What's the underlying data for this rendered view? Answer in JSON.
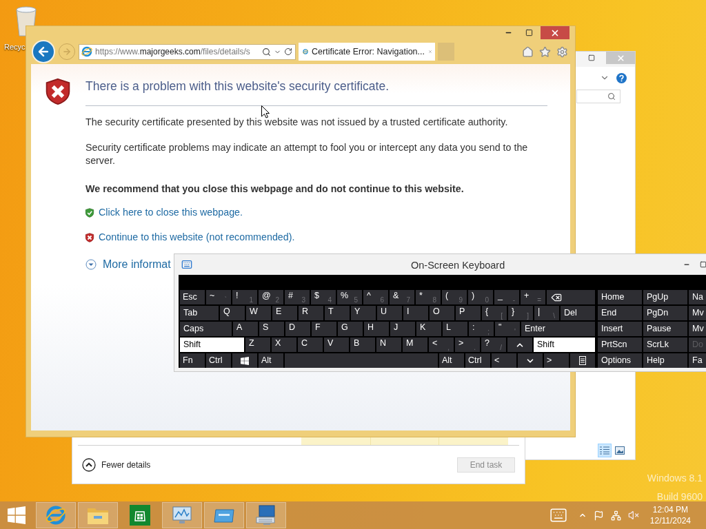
{
  "desktop": {
    "recycle_bin_label": "Recyc",
    "watermark": [
      "Windows 8.1",
      "Build 9600"
    ]
  },
  "explorer": {
    "views": [
      {
        "kind": "details",
        "selected": true
      },
      {
        "kind": "icons",
        "selected": false
      }
    ]
  },
  "task_manager": {
    "fewer_details": "Fewer details",
    "end_task": {
      "label": "End task",
      "disabled": true
    }
  },
  "browser": {
    "url": {
      "prefix": "https://www.",
      "domain": "majorgeeks.com",
      "path": "/files/details/s"
    },
    "tabs": [
      {
        "title": "Certificate Error: Navigation...",
        "selected": true
      }
    ],
    "page": {
      "heading": "There is a problem with this website's security certificate.",
      "paragraphs": [
        "The security certificate presented by this website was not issued by a trusted certificate authority.",
        "Security certificate problems may indicate an attempt to fool you or intercept any data you send to the server."
      ],
      "recommendation": "We recommend that you close this webpage and do not continue to this website.",
      "links": [
        {
          "label": "Click here to close this webpage.",
          "kind": "safe"
        },
        {
          "label": "Continue to this website (not recommended).",
          "kind": "unsafe"
        }
      ],
      "more_info": "More informat"
    }
  },
  "keyboard": {
    "title": "On-Screen Keyboard",
    "rows": [
      {
        "keys": [
          {
            "kind": "named",
            "label": "Esc",
            "on": false
          },
          {
            "kind": "char",
            "label": "~",
            "sub": "`",
            "on": false
          },
          {
            "kind": "char",
            "label": "!",
            "sub": "1",
            "on": false
          },
          {
            "kind": "char",
            "label": "@",
            "sub": "2",
            "on": false
          },
          {
            "kind": "char",
            "label": "#",
            "sub": "3",
            "on": false
          },
          {
            "kind": "char",
            "label": "$",
            "sub": "4",
            "on": false
          },
          {
            "kind": "char",
            "label": "%",
            "sub": "5",
            "on": false
          },
          {
            "kind": "char",
            "label": "^",
            "sub": "6",
            "on": false
          },
          {
            "kind": "char",
            "label": "&",
            "sub": "7",
            "on": false
          },
          {
            "kind": "char",
            "label": "*",
            "sub": "8",
            "on": false
          },
          {
            "kind": "char",
            "label": "(",
            "sub": "9",
            "on": false
          },
          {
            "kind": "char",
            "label": ")",
            "sub": "0",
            "on": false
          },
          {
            "kind": "char",
            "label": "_",
            "sub": "-",
            "on": false
          },
          {
            "kind": "char",
            "label": "+",
            "sub": "=",
            "on": false
          },
          {
            "kind": "backspace",
            "on": false
          }
        ]
      },
      {
        "keys": [
          {
            "kind": "wide",
            "label": "Tab",
            "on": false
          },
          {
            "kind": "char",
            "label": "Q",
            "on": false
          },
          {
            "kind": "char",
            "label": "W",
            "on": false
          },
          {
            "kind": "char",
            "label": "E",
            "on": false
          },
          {
            "kind": "char",
            "label": "R",
            "on": false
          },
          {
            "kind": "char",
            "label": "T",
            "on": false
          },
          {
            "kind": "char",
            "label": "Y",
            "on": false
          },
          {
            "kind": "char",
            "label": "U",
            "on": false
          },
          {
            "kind": "char",
            "label": "I",
            "on": false
          },
          {
            "kind": "char",
            "label": "O",
            "on": false
          },
          {
            "kind": "char",
            "label": "P",
            "on": false
          },
          {
            "kind": "char",
            "label": "{",
            "sub": "[",
            "on": false
          },
          {
            "kind": "char",
            "label": "}",
            "sub": "]",
            "on": false
          },
          {
            "kind": "char",
            "label": "|",
            "sub": "\\",
            "on": false
          },
          {
            "kind": "wide",
            "label": "Del",
            "on": false
          }
        ]
      },
      {
        "keys": [
          {
            "kind": "wide",
            "label": "Caps",
            "on": false
          },
          {
            "kind": "char",
            "label": "A",
            "on": false
          },
          {
            "kind": "char",
            "label": "S",
            "on": false
          },
          {
            "kind": "char",
            "label": "D",
            "on": false
          },
          {
            "kind": "char",
            "label": "F",
            "on": false
          },
          {
            "kind": "char",
            "label": "G",
            "on": false
          },
          {
            "kind": "char",
            "label": "H",
            "on": false
          },
          {
            "kind": "char",
            "label": "J",
            "on": false
          },
          {
            "kind": "char",
            "label": "K",
            "on": false
          },
          {
            "kind": "char",
            "label": "L",
            "on": false
          },
          {
            "kind": "char",
            "label": ":",
            "sub": ";",
            "on": false
          },
          {
            "kind": "char",
            "label": "\"",
            "sub": "'",
            "on": false
          },
          {
            "kind": "wide",
            "label": "Enter",
            "on": false
          }
        ]
      },
      {
        "keys": [
          {
            "kind": "wide",
            "label": "Shift",
            "on": true
          },
          {
            "kind": "char",
            "label": "Z",
            "on": false
          },
          {
            "kind": "char",
            "label": "X",
            "on": false
          },
          {
            "kind": "char",
            "label": "C",
            "on": false
          },
          {
            "kind": "char",
            "label": "V",
            "on": false
          },
          {
            "kind": "char",
            "label": "B",
            "on": false
          },
          {
            "kind": "char",
            "label": "N",
            "on": false
          },
          {
            "kind": "char",
            "label": "M",
            "on": false
          },
          {
            "kind": "char",
            "label": "<",
            "sub": ",",
            "on": false
          },
          {
            "kind": "char",
            "label": ">",
            "sub": ".",
            "on": false
          },
          {
            "kind": "char",
            "label": "?",
            "sub": "/",
            "on": false
          },
          {
            "kind": "up",
            "on": false
          },
          {
            "kind": "wide",
            "label": "Shift",
            "on": true
          }
        ]
      },
      {
        "keys": [
          {
            "kind": "named",
            "label": "Fn",
            "on": false
          },
          {
            "kind": "named",
            "label": "Ctrl",
            "on": false
          },
          {
            "kind": "windows",
            "on": false
          },
          {
            "kind": "named",
            "label": "Alt",
            "on": false
          },
          {
            "kind": "space",
            "on": false
          },
          {
            "kind": "named",
            "label": "Alt",
            "on": false
          },
          {
            "kind": "named",
            "label": "Ctrl",
            "on": false
          },
          {
            "kind": "named",
            "label": "<",
            "on": false
          },
          {
            "kind": "down",
            "on": false
          },
          {
            "kind": "named",
            "label": ">",
            "on": false
          },
          {
            "kind": "menu",
            "on": false
          }
        ]
      }
    ],
    "nav": [
      {
        "keys": [
          {
            "label": "Home",
            "disabled": false
          },
          {
            "label": "PgUp",
            "disabled": false
          },
          {
            "label": "Na",
            "disabled": false
          }
        ]
      },
      {
        "keys": [
          {
            "label": "End",
            "disabled": false
          },
          {
            "label": "PgDn",
            "disabled": false
          },
          {
            "label": "Mv",
            "disabled": false
          }
        ]
      },
      {
        "keys": [
          {
            "label": "Insert",
            "disabled": false
          },
          {
            "label": "Pause",
            "disabled": false
          },
          {
            "label": "Mv",
            "disabled": false
          }
        ]
      },
      {
        "keys": [
          {
            "label": "PrtScn",
            "disabled": false
          },
          {
            "label": "ScrLk",
            "disabled": false
          },
          {
            "label": "Do",
            "disabled": true
          }
        ]
      },
      {
        "keys": [
          {
            "label": "Options",
            "disabled": false
          },
          {
            "label": "Help",
            "disabled": false
          },
          {
            "label": "Fa",
            "disabled": false
          }
        ]
      }
    ]
  },
  "taskbar": {
    "apps": [
      {
        "kind": "ie",
        "running": true
      },
      {
        "kind": "explorer",
        "running": true
      },
      {
        "kind": "store",
        "running": false
      },
      {
        "kind": "taskmgr",
        "running": true
      },
      {
        "kind": "window",
        "running": true
      },
      {
        "kind": "osk",
        "running": true
      }
    ],
    "clock": {
      "time": "12:04 PM",
      "date": "12/11/2024"
    }
  }
}
